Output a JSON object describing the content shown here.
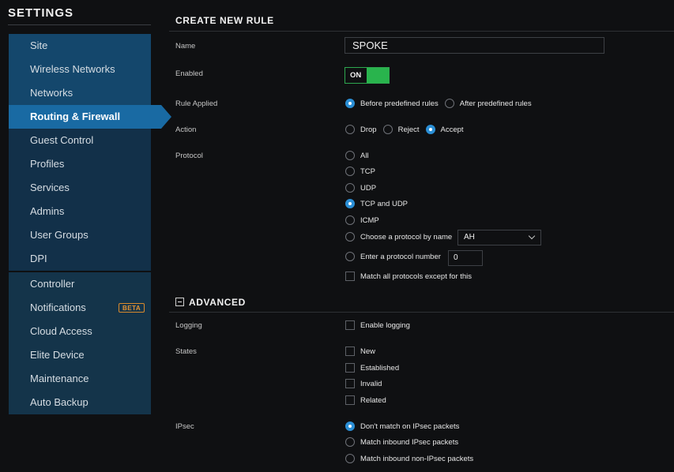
{
  "settings": {
    "title": "SETTINGS",
    "nav_primary": [
      {
        "label": "Site"
      },
      {
        "label": "Wireless Networks"
      },
      {
        "label": "Networks"
      },
      {
        "label": "Routing & Firewall",
        "active": true
      },
      {
        "label": "Guest Control"
      },
      {
        "label": "Profiles"
      },
      {
        "label": "Services"
      },
      {
        "label": "Admins"
      },
      {
        "label": "User Groups"
      },
      {
        "label": "DPI"
      }
    ],
    "nav_secondary": [
      {
        "label": "Controller"
      },
      {
        "label": "Notifications",
        "badge": "BETA"
      },
      {
        "label": "Cloud Access"
      },
      {
        "label": "Elite Device"
      },
      {
        "label": "Maintenance"
      },
      {
        "label": "Auto Backup"
      }
    ]
  },
  "form": {
    "title": "CREATE NEW RULE",
    "name": {
      "label": "Name",
      "value": "SPOKE"
    },
    "enabled": {
      "label": "Enabled",
      "state": "ON"
    },
    "rule_applied": {
      "label": "Rule Applied",
      "options": [
        "Before predefined rules",
        "After predefined rules"
      ],
      "selected": "Before predefined rules"
    },
    "action": {
      "label": "Action",
      "options": [
        "Drop",
        "Reject",
        "Accept"
      ],
      "selected": "Accept"
    },
    "protocol": {
      "label": "Protocol",
      "options": [
        "All",
        "TCP",
        "UDP",
        "TCP and UDP",
        "ICMP",
        "Choose a protocol by name",
        "Enter a protocol number"
      ],
      "selected": "TCP and UDP",
      "protocol_name_value": "AH",
      "protocol_number_value": "0",
      "match_all_except": "Match all protocols except for this"
    },
    "advanced": {
      "title": "ADVANCED",
      "logging": {
        "label": "Logging",
        "option": "Enable logging"
      },
      "states": {
        "label": "States",
        "options": [
          "New",
          "Established",
          "Invalid",
          "Related"
        ]
      },
      "ipsec": {
        "label": "IPsec",
        "options": [
          "Don't match on IPsec packets",
          "Match inbound IPsec packets",
          "Match inbound non-IPsec packets"
        ],
        "selected": "Don't match on IPsec packets"
      }
    }
  },
  "colors": {
    "accent": "#196aa3",
    "toggle_on": "#29b44d",
    "badge": "#e69433",
    "background": "#0f1012"
  }
}
